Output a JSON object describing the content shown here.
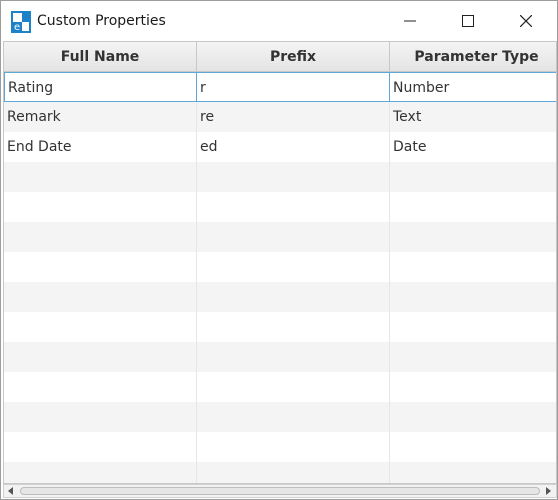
{
  "window": {
    "title": "Custom Properties",
    "icon": "app-logo-icon",
    "controls": [
      "minimize-icon",
      "maximize-icon",
      "close-icon"
    ]
  },
  "table": {
    "columns": [
      "Full Name",
      "Prefix",
      "Parameter Type"
    ],
    "rows": [
      [
        "Rating",
        "r",
        "Number"
      ],
      [
        "Remark",
        "re",
        "Text"
      ],
      [
        "End Date",
        "ed",
        "Date"
      ]
    ],
    "empty_row_count": 11,
    "selected_row": 0
  },
  "colors": {
    "focus_border": "#5ea7d6",
    "stripe": "#f4f4f4",
    "header_bg": "#e8e8e8"
  }
}
